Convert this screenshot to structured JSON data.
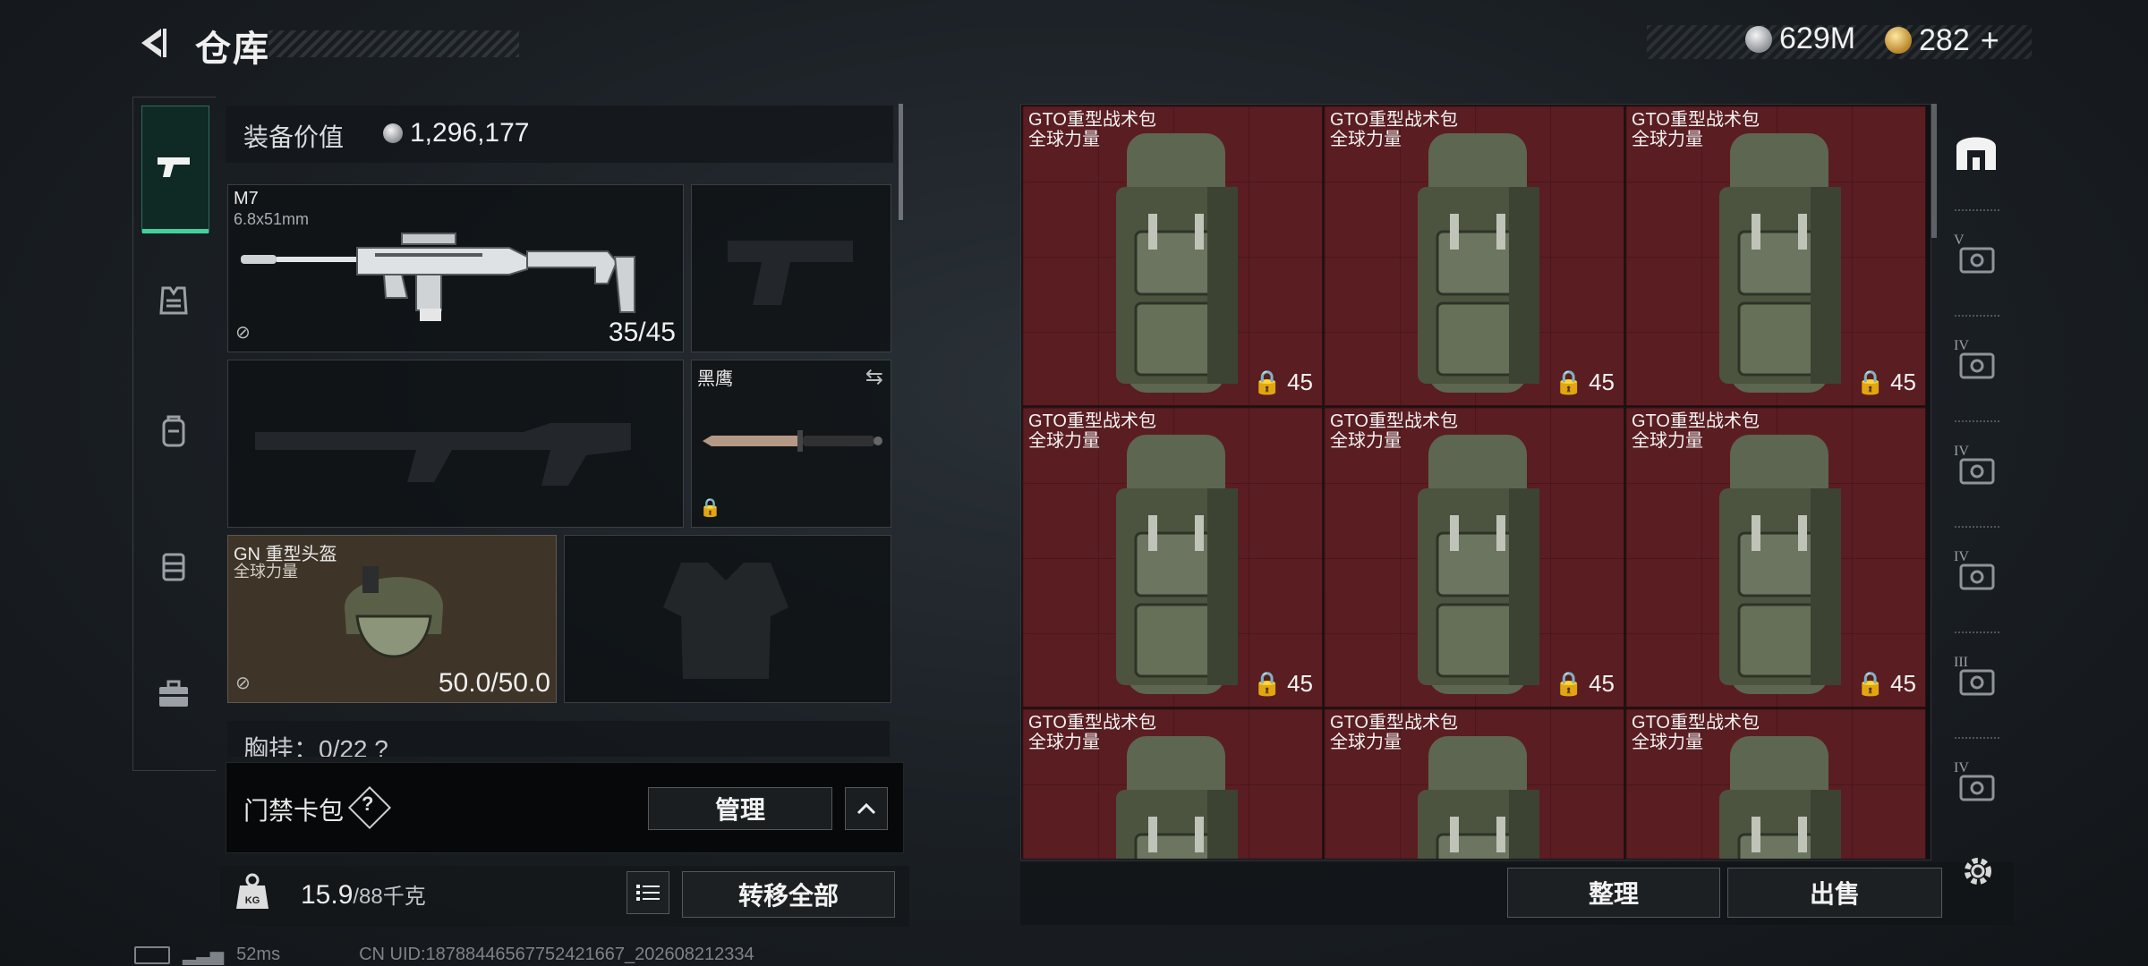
{
  "header": {
    "title": "仓库",
    "currencies": [
      {
        "value": "629M",
        "icon": "silver-coin-icon"
      },
      {
        "value": "282",
        "icon": "gold-coin-icon",
        "suffix": "+"
      }
    ]
  },
  "left_rail": {
    "items": [
      {
        "name": "weapon-tab",
        "icon": "pistol-icon",
        "active": true
      },
      {
        "name": "armor-tab",
        "icon": "vest-icon"
      },
      {
        "name": "backpack-tab",
        "icon": "backpack-icon"
      },
      {
        "name": "container-tab",
        "icon": "case-icon"
      },
      {
        "name": "briefcase-tab",
        "icon": "briefcase-icon"
      }
    ]
  },
  "loadout": {
    "value_label": "装备价值",
    "value": "1,296,177",
    "primary": {
      "name": "M7",
      "caliber": "6.8x51mm",
      "ammo": "35/45"
    },
    "secondary_empty": true,
    "melee": {
      "name": "黑鹰"
    },
    "helmet": {
      "name": "GN 重型头盔",
      "faction": "全球力量",
      "durability": "50.0/50.0"
    },
    "chest_partial": "胸挂：0/22  ?"
  },
  "card_bag": {
    "label": "门禁卡包",
    "help": "?",
    "manage_label": "管理"
  },
  "weight": {
    "current": "15.9",
    "max": "/88千克",
    "transfer_all": "转移全部"
  },
  "status": {
    "ping": "52ms",
    "uid": "CN UID:18788446567752421667_202608212334"
  },
  "stash": {
    "items": [
      {
        "name": "GTO重型战术包",
        "faction": "全球力量",
        "capacity": "45"
      },
      {
        "name": "GTO重型战术包",
        "faction": "全球力量",
        "capacity": "45"
      },
      {
        "name": "GTO重型战术包",
        "faction": "全球力量",
        "capacity": "45"
      },
      {
        "name": "GTO重型战术包",
        "faction": "全球力量",
        "capacity": "45"
      },
      {
        "name": "GTO重型战术包",
        "faction": "全球力量",
        "capacity": "45"
      },
      {
        "name": "GTO重型战术包",
        "faction": "全球力量",
        "capacity": "45"
      },
      {
        "name": "GTO重型战术包",
        "faction": "全球力量",
        "capacity": ""
      },
      {
        "name": "GTO重型战术包",
        "faction": "全球力量",
        "capacity": ""
      },
      {
        "name": "GTO重型战术包",
        "faction": "全球力量",
        "capacity": ""
      }
    ],
    "sort_label": "整理",
    "sell_label": "出售"
  },
  "right_rail": {
    "items": [
      {
        "name": "stash-main-tab",
        "label": ""
      },
      {
        "name": "stash-tab-5",
        "label": "V"
      },
      {
        "name": "stash-tab-4a",
        "label": "IV"
      },
      {
        "name": "stash-tab-4b",
        "label": "IV"
      },
      {
        "name": "stash-tab-4c",
        "label": "IV"
      },
      {
        "name": "stash-tab-3",
        "label": "III"
      },
      {
        "name": "stash-tab-4d",
        "label": "IV"
      }
    ]
  },
  "colors": {
    "accent": "#3fd39b",
    "stash_cell": "#5a1d22",
    "helmet_cell": "#3e3428"
  }
}
